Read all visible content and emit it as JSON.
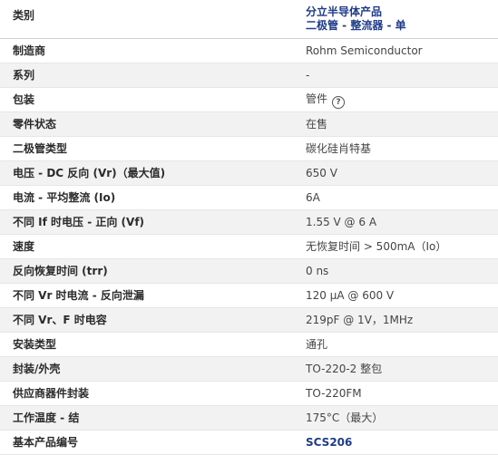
{
  "header": {
    "label": "类别",
    "category_line1": "分立半导体产品",
    "category_line2": "二极管 - 整流器 - 单"
  },
  "rows": [
    {
      "label": "制造商",
      "value": "Rohm Semiconductor"
    },
    {
      "label": "系列",
      "value": "-"
    },
    {
      "label": "包装",
      "value": "管件",
      "icon": "help-circle-icon",
      "icon_glyph": "?"
    },
    {
      "label": "零件状态",
      "value": "在售"
    },
    {
      "label": "二极管类型",
      "value": "碳化硅肖特基"
    },
    {
      "label": "电压 - DC 反向 (Vr)（最大值)",
      "value": "650 V"
    },
    {
      "label": "电流 - 平均整流 (Io)",
      "value": "6A"
    },
    {
      "label": "不同 If 时电压 - 正向 (Vf)",
      "value": "1.55 V @ 6 A"
    },
    {
      "label": "速度",
      "value": "无恢复时间 > 500mA（Io）"
    },
    {
      "label": "反向恢复时间 (trr)",
      "value": "0 ns"
    },
    {
      "label": "不同 Vr 时电流 - 反向泄漏",
      "value": "120 µA @ 600 V"
    },
    {
      "label": "不同 Vr、F 时电容",
      "value": "219pF @ 1V，1MHz"
    },
    {
      "label": "安装类型",
      "value": "通孔"
    },
    {
      "label": "封装/外壳",
      "value": "TO-220-2 整包"
    },
    {
      "label": "供应商器件封装",
      "value": "TO-220FM"
    },
    {
      "label": "工作温度 - 结",
      "value": "175°C（最大）"
    },
    {
      "label": "基本产品编号",
      "value": "SCS206"
    }
  ],
  "colors": {
    "link": "#1f3c88",
    "stripe": "#f2f2f2",
    "border": "#e6e6e6"
  }
}
